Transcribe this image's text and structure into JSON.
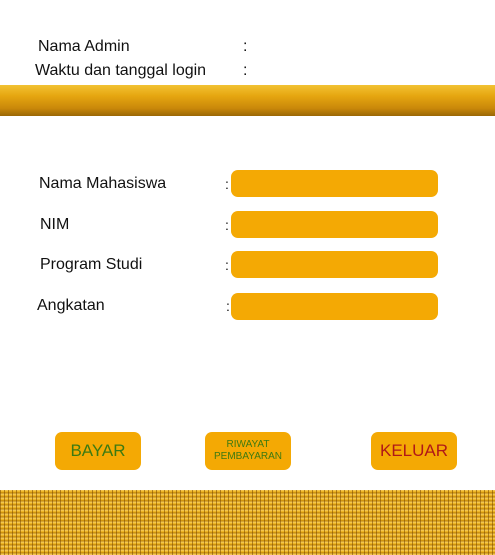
{
  "header": {
    "admin_name_label": "Nama Admin",
    "admin_name_colon": ":",
    "login_time_label": "Waktu dan tanggal login",
    "login_time_colon": ":"
  },
  "form": {
    "fields": [
      {
        "label": "Nama Mahasiswa",
        "colon": ":",
        "value": ""
      },
      {
        "label": "NIM",
        "colon": ":",
        "value": ""
      },
      {
        "label": "Program Studi",
        "colon": ":",
        "value": ""
      },
      {
        "label": "Angkatan",
        "colon": ":",
        "value": ""
      }
    ]
  },
  "buttons": {
    "bayar": "BAYAR",
    "riwayat": "RIWAYAT\nPEMBAYARAN",
    "keluar": "KELUAR"
  },
  "colors": {
    "accent": "#f4a904",
    "bar_gold": "#e6a610",
    "button_green_text": "#3c7a12",
    "button_red_text": "#b01818"
  }
}
